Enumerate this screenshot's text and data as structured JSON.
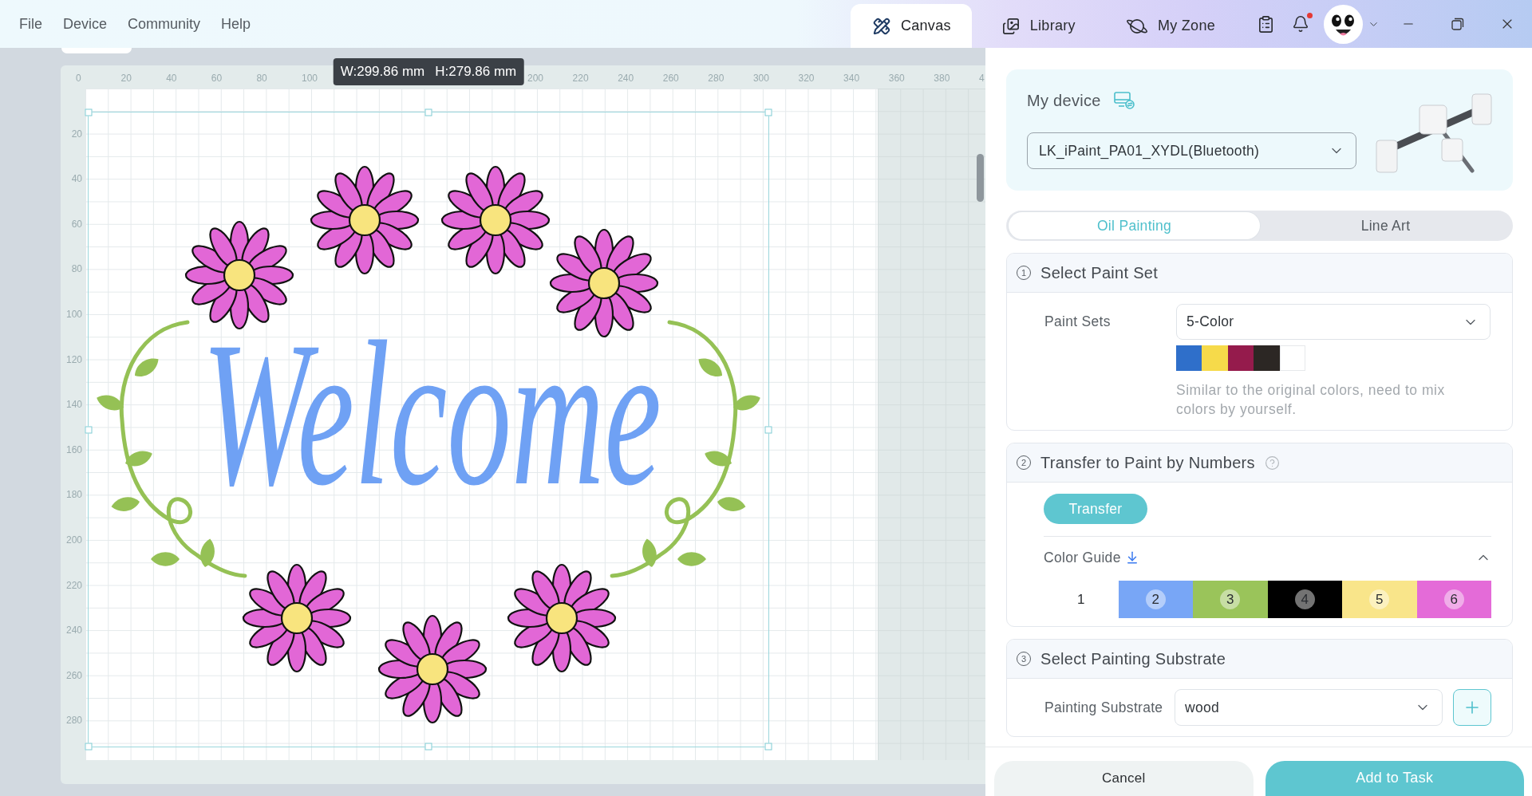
{
  "menu": [
    {
      "label": "File"
    },
    {
      "label": "Device"
    },
    {
      "label": "Community"
    },
    {
      "label": "Help"
    }
  ],
  "tabs": [
    {
      "label": "Canvas",
      "kind": "canvas",
      "selected": true
    },
    {
      "label": "Library",
      "kind": "library",
      "selected": false
    },
    {
      "label": "My Zone",
      "kind": "zone",
      "selected": false
    }
  ],
  "notifications": {
    "unread": true
  },
  "canvas": {
    "size_tooltip": {
      "width_reading": "W:299.86 mm",
      "height_reading": "H:279.86 mm"
    },
    "top_ruler": {
      "labels_before_tooltip": [
        "0",
        "20",
        "40",
        "60",
        "80",
        "100"
      ],
      "labels_after_tooltip": [
        "200",
        "220",
        "240",
        "260",
        "280",
        "300",
        "320",
        "340",
        "360",
        "380",
        "4"
      ]
    },
    "left_ruler": {
      "labels": [
        "20",
        "40",
        "60",
        "80",
        "100",
        "120",
        "140",
        "160",
        "180",
        "200",
        "220",
        "240",
        "260",
        "280"
      ]
    },
    "artwork_text": "Welcome"
  },
  "device": {
    "title": "My device",
    "selected_device": "LK_iPaint_PA01_XYDL(Bluetooth)"
  },
  "modes": [
    {
      "label": "Oil Painting",
      "selected": true
    },
    {
      "label": "Line Art",
      "selected": false
    }
  ],
  "steps": [
    {
      "kind": "paint_set",
      "number": "1",
      "title": "Select Paint Set",
      "field_label": "Paint Sets",
      "value": "5-Color",
      "swatches": [
        {
          "color": "#2f6fca"
        },
        {
          "color": "#f6da4a"
        },
        {
          "color": "#951b4c"
        },
        {
          "color": "#2c2724"
        },
        {
          "color": "#ffffff"
        }
      ],
      "note": "Similar to the original colors, need to mix colors by yourself."
    },
    {
      "kind": "transfer",
      "number": "2",
      "title": "Transfer to Paint by Numbers",
      "button": "Transfer",
      "color_guide": {
        "label": "Color Guide",
        "expanded": true,
        "colors": [
          {
            "number": "1",
            "color": "#ffffff"
          },
          {
            "number": "2",
            "color": "#78a6f6"
          },
          {
            "number": "3",
            "color": "#9ac45a"
          },
          {
            "number": "4",
            "color": "#000000"
          },
          {
            "number": "5",
            "color": "#f9e58a"
          },
          {
            "number": "6",
            "color": "#e46bd8"
          }
        ]
      }
    },
    {
      "kind": "substrate",
      "number": "3",
      "title": "Select Painting Substrate",
      "field_label": "Painting Substrate",
      "value": "wood"
    }
  ],
  "actions": [
    {
      "label": "Cancel",
      "kind": "secondary"
    },
    {
      "label": "Add to Task",
      "kind": "primary"
    }
  ]
}
